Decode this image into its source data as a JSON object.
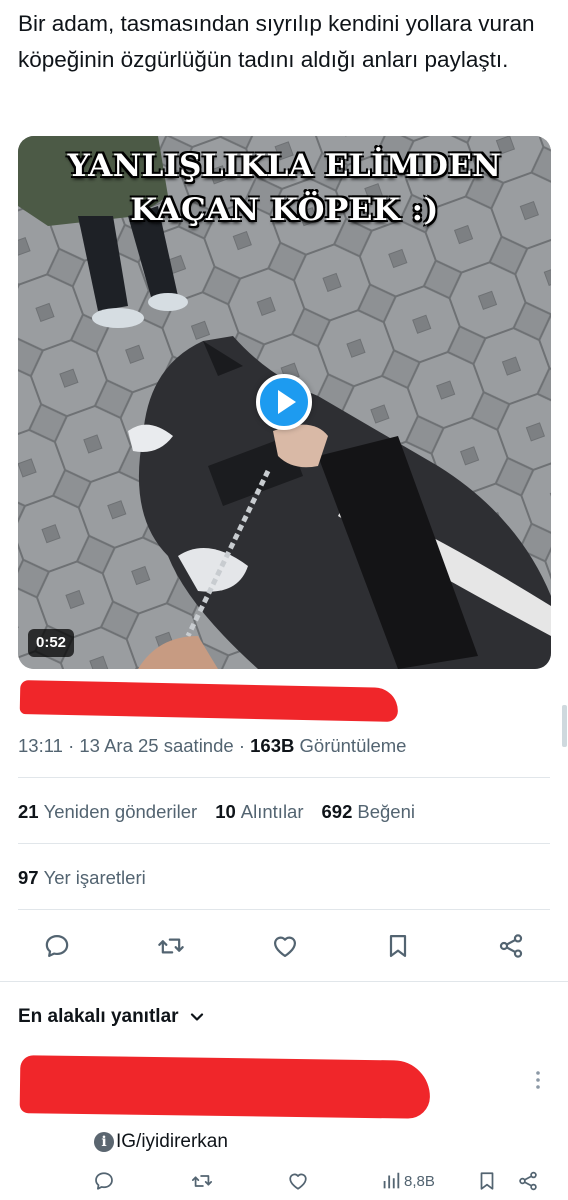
{
  "tweet": {
    "text": "Bir adam, tasmasından sıyrılıp kendini yollara vuran köpeğinin özgürlüğün tadını aldığı anları paylaştı."
  },
  "video": {
    "caption_line1": "YANLIŞLIKLA ELİMDEN",
    "caption_line2": "KAÇAN KÖPEK :)",
    "duration": "0:52",
    "play_icon": "play-icon",
    "accent_color": "#1d9bf0"
  },
  "meta": {
    "time": "13:11",
    "sep1": " · ",
    "date": "13 Ara 25 saatinde",
    "sep2": " · ",
    "views_count": "163B",
    "views_label": " Görüntüleme"
  },
  "stats": {
    "reposts_count": "21",
    "reposts_label": "Yeniden gönderiler",
    "quotes_count": "10",
    "quotes_label": "Alıntılar",
    "likes_count": "692",
    "likes_label": "Beğeni",
    "bookmarks_count": "97",
    "bookmarks_label": "Yer işaretleri"
  },
  "actions": [
    "reply-icon",
    "repost-icon",
    "like-icon",
    "bookmark-icon",
    "share-icon"
  ],
  "replies": {
    "header": "En alakalı yanıtlar",
    "reply_handle": "IG/iyidirerkan",
    "reply_views": "8,8B"
  },
  "colors": {
    "text_primary": "#0f1419",
    "text_secondary": "#536471",
    "redaction": "#f0262a",
    "divider": "#e1e6ea"
  }
}
